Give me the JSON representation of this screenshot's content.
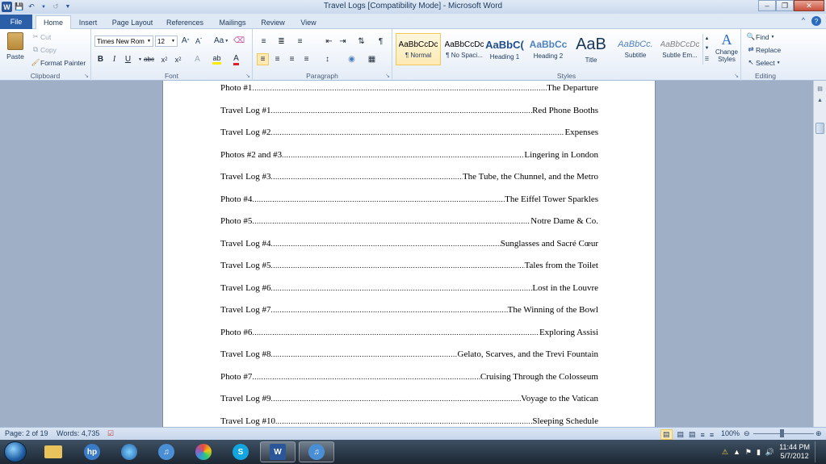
{
  "window": {
    "title": "Travel Logs [Compatibility Mode]  -  Microsoft Word",
    "app_icon": "W"
  },
  "tabs": {
    "file": "File",
    "items": [
      "Home",
      "Insert",
      "Page Layout",
      "References",
      "Mailings",
      "Review",
      "View"
    ],
    "active": "Home"
  },
  "ribbon": {
    "clipboard": {
      "label": "Clipboard",
      "paste": "Paste",
      "cut": "Cut",
      "copy": "Copy",
      "format_painter": "Format Painter"
    },
    "font": {
      "label": "Font",
      "font_name": "Times New Rom",
      "font_size": "12",
      "change_case": "Aa"
    },
    "paragraph": {
      "label": "Paragraph"
    },
    "styles": {
      "label": "Styles",
      "tiles": [
        {
          "sample": "AaBbCcDc",
          "name": "¶ Normal"
        },
        {
          "sample": "AaBbCcDc",
          "name": "¶ No Spaci..."
        },
        {
          "sample": "AaBbC(",
          "name": "Heading 1"
        },
        {
          "sample": "AaBbCc",
          "name": "Heading 2"
        },
        {
          "sample": "AaB",
          "name": "Title"
        },
        {
          "sample": "AaBbCc.",
          "name": "Subtitle"
        },
        {
          "sample": "AaBbCcDc",
          "name": "Subtle Em..."
        }
      ],
      "change_styles": "Change Styles"
    },
    "editing": {
      "label": "Editing",
      "find": "Find",
      "replace": "Replace",
      "select": "Select"
    }
  },
  "document": {
    "toc": [
      {
        "label": "Photo #1",
        "title": "The Departure"
      },
      {
        "label": "Travel Log #1",
        "title": "Red Phone Booths"
      },
      {
        "label": "Travel Log #2",
        "title": "Expenses"
      },
      {
        "label": "Photos #2 and #3",
        "title": "Lingering in London"
      },
      {
        "label": "Travel Log #3",
        "title": "The Tube, the Chunnel, and the Metro"
      },
      {
        "label": "Photo #4",
        "title": "The Eiffel Tower Sparkles"
      },
      {
        "label": "Photo #5",
        "title": "Notre Dame & Co."
      },
      {
        "label": "Travel Log #4",
        "title": "Sunglasses and Sacré Cœur"
      },
      {
        "label": "Travel Log #5",
        "title": "Tales  from the Toilet"
      },
      {
        "label": "Travel Log #6",
        "title": "Lost in the Louvre"
      },
      {
        "label": "Travel Log #7",
        "title": "The Winning of the Bowl"
      },
      {
        "label": "Photo #6",
        "title": "Exploring Assisi"
      },
      {
        "label": "Travel Log #8",
        "title": "Gelato, Scarves, and the Trevi Fountain"
      },
      {
        "label": "Photo #7",
        "title": "Cruising Through the Colosseum"
      },
      {
        "label": "Travel Log #9",
        "title": "Voyage to the Vatican"
      },
      {
        "label": "Travel Log #10",
        "title": "Sleeping Schedule"
      }
    ]
  },
  "statusbar": {
    "page": "Page: 2 of 19",
    "words": "Words: 4,735",
    "zoom": "100%"
  },
  "taskbar": {
    "time": "11:44 PM",
    "date": "5/7/2012"
  }
}
